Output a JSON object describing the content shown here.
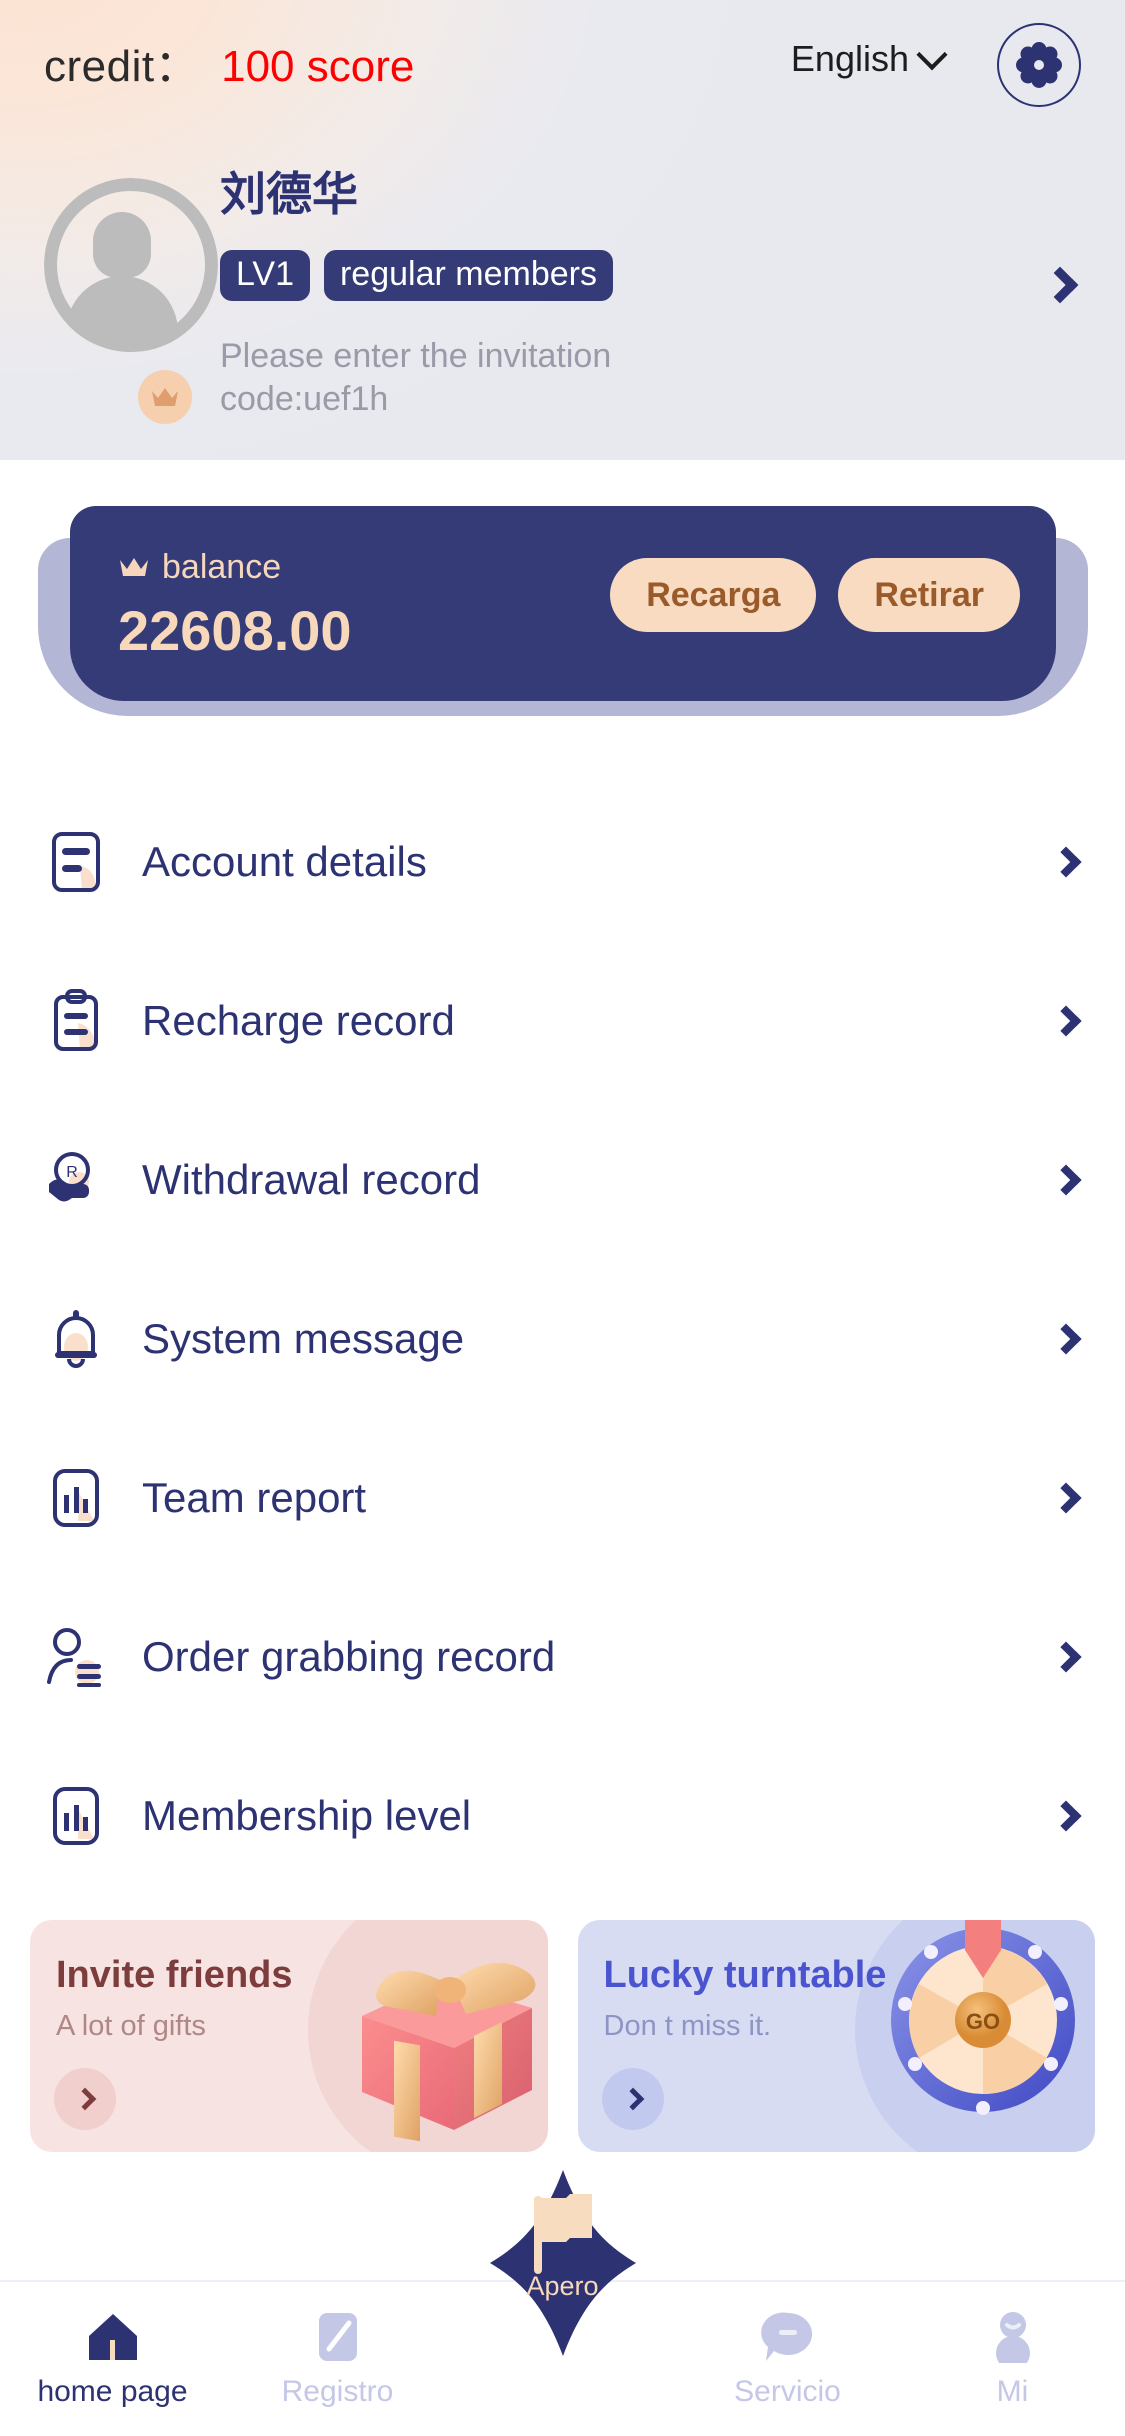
{
  "header": {
    "credit_label": "credit：",
    "credit_value": "100 score",
    "language": "English",
    "language_chevron": "chevron-down-icon",
    "settings_icon": "gear-icon",
    "profile": {
      "username": "刘德华",
      "level_badge": "LV1",
      "member_badge": "regular members",
      "invitation_note": "Please enter the invitation code:uef1h",
      "avatar_icon": "avatar-placeholder-icon",
      "crown_icon": "crown-icon",
      "chevron": "chevron-right-icon"
    }
  },
  "balance": {
    "label": "balance",
    "crown_icon": "crown-icon",
    "amount": "22608.00",
    "recharge_label": "Recarga",
    "withdraw_label": "Retirar"
  },
  "menu": {
    "items": [
      {
        "label": "Account details",
        "icon": "document-lines-icon"
      },
      {
        "label": "Recharge record",
        "icon": "clipboard-icon"
      },
      {
        "label": "Withdrawal record",
        "icon": "hand-coin-r-icon"
      },
      {
        "label": "System message",
        "icon": "bell-icon"
      },
      {
        "label": "Team report",
        "icon": "bar-chart-icon"
      },
      {
        "label": "Order grabbing record",
        "icon": "person-list-icon"
      },
      {
        "label": "Membership level",
        "icon": "bar-chart-icon"
      }
    ],
    "chevron": "chevron-right-icon"
  },
  "promos": [
    {
      "title": "Invite friends",
      "subtitle": "A lot of gifts",
      "art": "gift-box-illustration",
      "go_icon": "chevron-right-icon"
    },
    {
      "title": "Lucky turntable",
      "subtitle": "Don t miss it.",
      "art": "fortune-wheel-illustration",
      "wheel_button_label": "GO",
      "go_icon": "chevron-right-icon"
    }
  ],
  "tabbar": {
    "items": [
      {
        "label": "home page",
        "icon": "home-icon",
        "active": true
      },
      {
        "label": "Registro",
        "icon": "note-icon",
        "active": false
      },
      {
        "label": "",
        "icon": "flag-icon",
        "active": false
      },
      {
        "label": "Servicio",
        "icon": "chat-bubble-icon",
        "active": false
      },
      {
        "label": "Mi",
        "icon": "person-icon",
        "active": false
      }
    ],
    "fab_label": "Apero"
  },
  "colors": {
    "navy": "#2d3273",
    "navy_deep": "#353b77",
    "peach": "#f8dbc0",
    "red": "#ff0000",
    "muted": "#9a9aa8",
    "tab_inactive": "#c4c8e6"
  }
}
